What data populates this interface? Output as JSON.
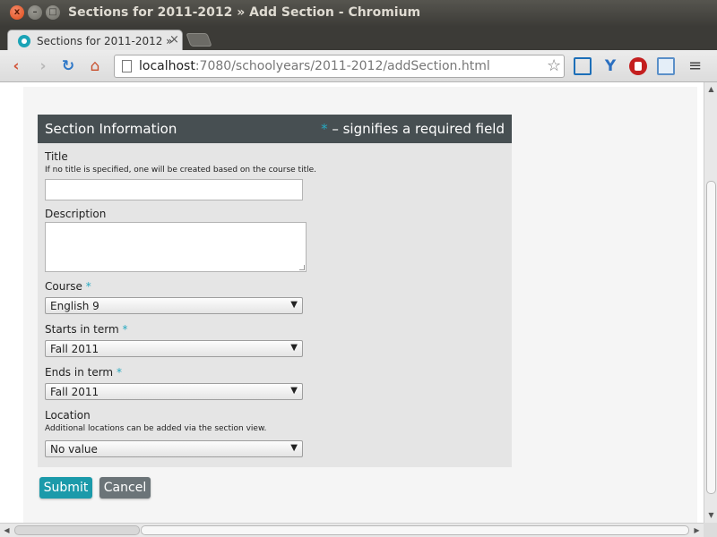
{
  "window": {
    "title": "Sections for 2011-2012 » Add Section - Chromium",
    "close_glyph": "x",
    "minimize_glyph": "–",
    "maximize_glyph": "□"
  },
  "tab": {
    "title": "Sections for 2011-2012 »",
    "close_glyph": "×"
  },
  "toolbar": {
    "back_glyph": "‹",
    "forward_glyph": "›",
    "reload_glyph": "↻",
    "home_glyph": "⌂",
    "url_host": "localhost",
    "url_rest": ":7080/schoolyears/2011-2012/addSection.html",
    "star_glyph": "☆",
    "ext2_glyph": "Y",
    "menu_glyph": "≡"
  },
  "panel": {
    "title": "Section Information",
    "required_star": "*",
    "required_note": " – signifies a required field"
  },
  "fields": {
    "title": {
      "label": "Title",
      "hint": "If no title is specified, one will be created based on the course title.",
      "value": ""
    },
    "description": {
      "label": "Description",
      "value": ""
    },
    "course": {
      "label": "Course",
      "required_star": "*",
      "value": "English 9"
    },
    "starts_in_term": {
      "label": "Starts in term",
      "required_star": "*",
      "value": "Fall 2011"
    },
    "ends_in_term": {
      "label": "Ends in term",
      "required_star": "*",
      "value": "Fall 2011"
    },
    "location": {
      "label": "Location",
      "hint": "Additional locations can be added via the section view.",
      "value": "No value"
    }
  },
  "select_arrow": "▼",
  "buttons": {
    "submit": "Submit",
    "cancel": "Cancel"
  },
  "scrollbar": {
    "up": "▲",
    "down": "▼",
    "left": "◀",
    "right": "▶"
  },
  "colors": {
    "panel_header": "#474f52",
    "accent": "#1b9aaa",
    "required_star": "#26a9c1",
    "cancel_button": "#6b7478"
  }
}
